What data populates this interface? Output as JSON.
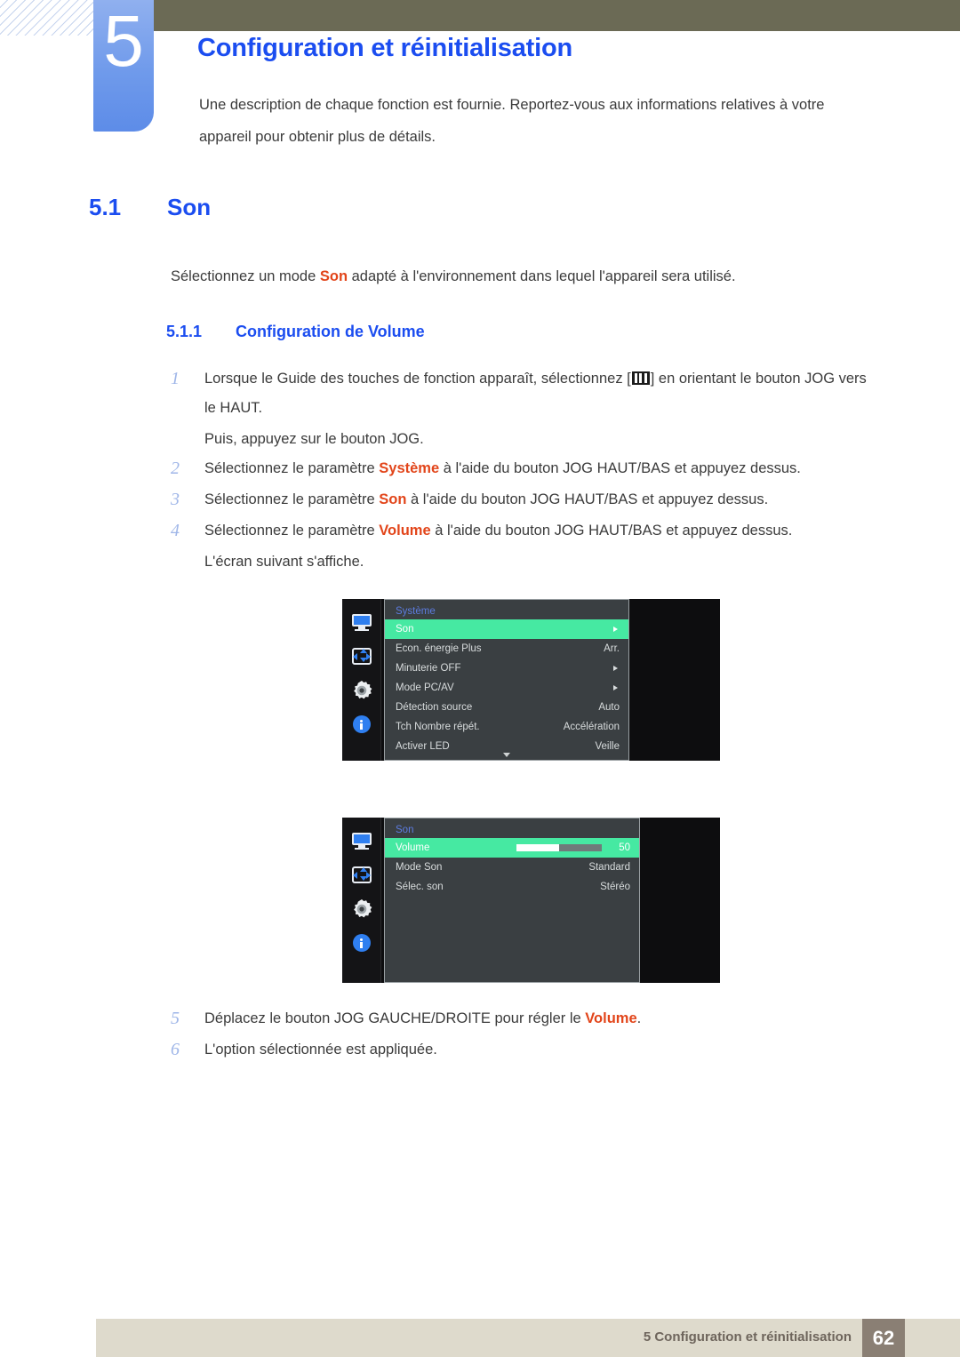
{
  "header": {
    "chapter_number": "5",
    "chapter_title": "Configuration et réinitialisation",
    "chapter_intro": "Une description de chaque fonction est fournie. Reportez-vous aux informations relatives à votre appareil pour obtenir plus de détails.",
    "olive_color": "#6b6a55",
    "badge_color": "#6f9aeb",
    "title_color": "#1b4df0"
  },
  "section": {
    "number": "5.1",
    "title": "Son",
    "intro_before": "Sélectionnez un mode ",
    "intro_highlight": "Son",
    "intro_after": " adapté à l'environnement dans lequel l'appareil sera utilisé.",
    "sub_number": "5.1.1",
    "sub_title": "Configuration de Volume"
  },
  "steps_top": [
    {
      "num": "1",
      "part1": "Lorsque le Guide des touches de fonction apparaît, sélectionnez [",
      "icon": "osd-menu-icon",
      "part2": "] en orientant le bouton JOG vers le HAUT.",
      "sub": "Puis, appuyez sur le bouton JOG."
    },
    {
      "num": "2",
      "part1": "Sélectionnez le paramètre ",
      "highlight": "Système",
      "part2": " à l'aide du bouton JOG HAUT/BAS et appuyez dessus."
    },
    {
      "num": "3",
      "part1": "Sélectionnez le paramètre ",
      "highlight": "Son",
      "part2": " à l'aide du bouton JOG HAUT/BAS et appuyez dessus."
    },
    {
      "num": "4",
      "part1": "Sélectionnez le paramètre ",
      "highlight": "Volume",
      "part2": " à l'aide du bouton JOG HAUT/BAS et appuyez dessus.",
      "sub": "L'écran suivant s'affiche."
    }
  ],
  "steps_bottom": [
    {
      "num": "5",
      "part1": "Déplacez le bouton JOG GAUCHE/DROITE pour régler le ",
      "highlight": "Volume",
      "part2": "."
    },
    {
      "num": "6",
      "part1": "L'option sélectionnée est appliquée."
    }
  ],
  "osd_screens": [
    {
      "name": "systeme-menu",
      "title": "Système",
      "sidebar_icons": [
        "monitor-icon",
        "position-icon",
        "gear-icon",
        "info-icon"
      ],
      "highlight_color": "#46e9a2",
      "has_scroll_down": true,
      "rows": [
        {
          "label": "Son",
          "value": "",
          "arrow": true,
          "selected": true
        },
        {
          "label": "Econ. énergie Plus",
          "value": "Arr.",
          "arrow": false,
          "selected": false
        },
        {
          "label": "Minuterie OFF",
          "value": "",
          "arrow": true,
          "selected": false
        },
        {
          "label": "Mode PC/AV",
          "value": "",
          "arrow": true,
          "selected": false
        },
        {
          "label": "Détection source",
          "value": "Auto",
          "arrow": false,
          "selected": false
        },
        {
          "label": "Tch Nombre répét.",
          "value": "Accélération",
          "arrow": false,
          "selected": false
        },
        {
          "label": "Activer LED",
          "value": "Veille",
          "arrow": false,
          "selected": false
        }
      ]
    },
    {
      "name": "son-menu",
      "title": "Son",
      "sidebar_icons": [
        "monitor-icon",
        "position-icon",
        "gear-icon",
        "info-icon"
      ],
      "highlight_color": "#46e9a2",
      "has_scroll_down": false,
      "rows": [
        {
          "label": "Volume",
          "value": "50",
          "slider": 50,
          "arrow": false,
          "selected": true
        },
        {
          "label": "Mode Son",
          "value": "Standard",
          "arrow": false,
          "selected": false
        },
        {
          "label": "Sélec. son",
          "value": "Stéréo",
          "arrow": false,
          "selected": false
        }
      ]
    }
  ],
  "footer": {
    "text": "5 Configuration et réinitialisation",
    "page": "62",
    "bar_color": "#dedacc",
    "page_box_color": "#8a7f74"
  }
}
